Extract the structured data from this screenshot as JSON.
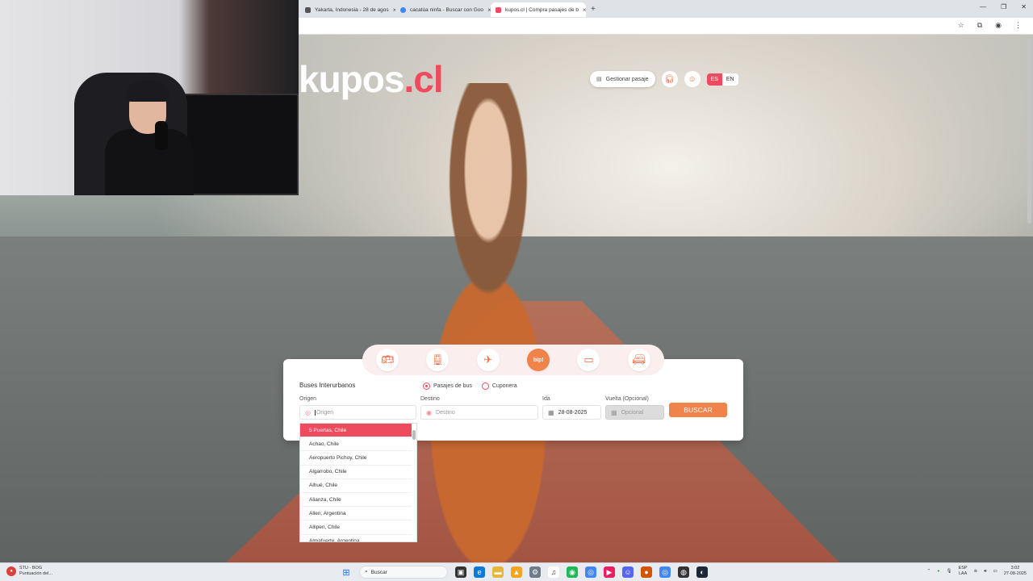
{
  "browser": {
    "tabs": [
      {
        "title": "Yakarta, Indonesia - 28 de agos",
        "icon": "wikipedia-icon",
        "color": "#333333",
        "active": false
      },
      {
        "title": "cacatúa ninfa - Buscar con Goo",
        "icon": "google-icon",
        "color": "#4285f4",
        "active": false
      },
      {
        "title": "kupos.cl | Compra pasajes de b",
        "icon": "kupos-icon",
        "color": "#ef4b5e",
        "active": true
      }
    ],
    "new_tab": "+",
    "close": "×",
    "window_controls": [
      "—",
      "❐",
      "✕"
    ]
  },
  "site": {
    "logo_main": "kupos",
    "logo_suffix": ".cl",
    "gestionar": "Gestionar pasaje",
    "lang_es": "ES",
    "lang_en": "EN",
    "accent": "#ef4b5e",
    "orange": "#f0834a"
  },
  "search": {
    "title": "Buses Interurbanos",
    "radio_bus": "Pasajes de bus",
    "radio_cuponera": "Cuponera",
    "origen_label": "Origen",
    "origen_placeholder": "Origen",
    "destino_label": "Destino",
    "destino_placeholder": "Destino",
    "ida_label": "Ida",
    "ida_value": "28-08-2025",
    "vuelta_label": "Vuelta (Opcional)",
    "vuelta_placeholder": "Opcional",
    "button": "BUSCAR"
  },
  "dropdown": {
    "items": [
      "5 Puertas, Chile",
      "Achao, Chile",
      "Aeropuerto Pichoy, Chile",
      "Algarrobo, Chile",
      "Alhué, Chile",
      "Alianza, Chile",
      "Allen, Argentina",
      "Allipen, Chile",
      "Almafuerte, Argentina"
    ],
    "selected_index": 0
  },
  "taskbar": {
    "left_title": "STU - BOG",
    "left_sub": "Puntuación del...",
    "search": "Buscar",
    "lang_top": "ESP",
    "lang_bottom": "LAA",
    "time": "3:02",
    "date": "27-08-2025"
  }
}
